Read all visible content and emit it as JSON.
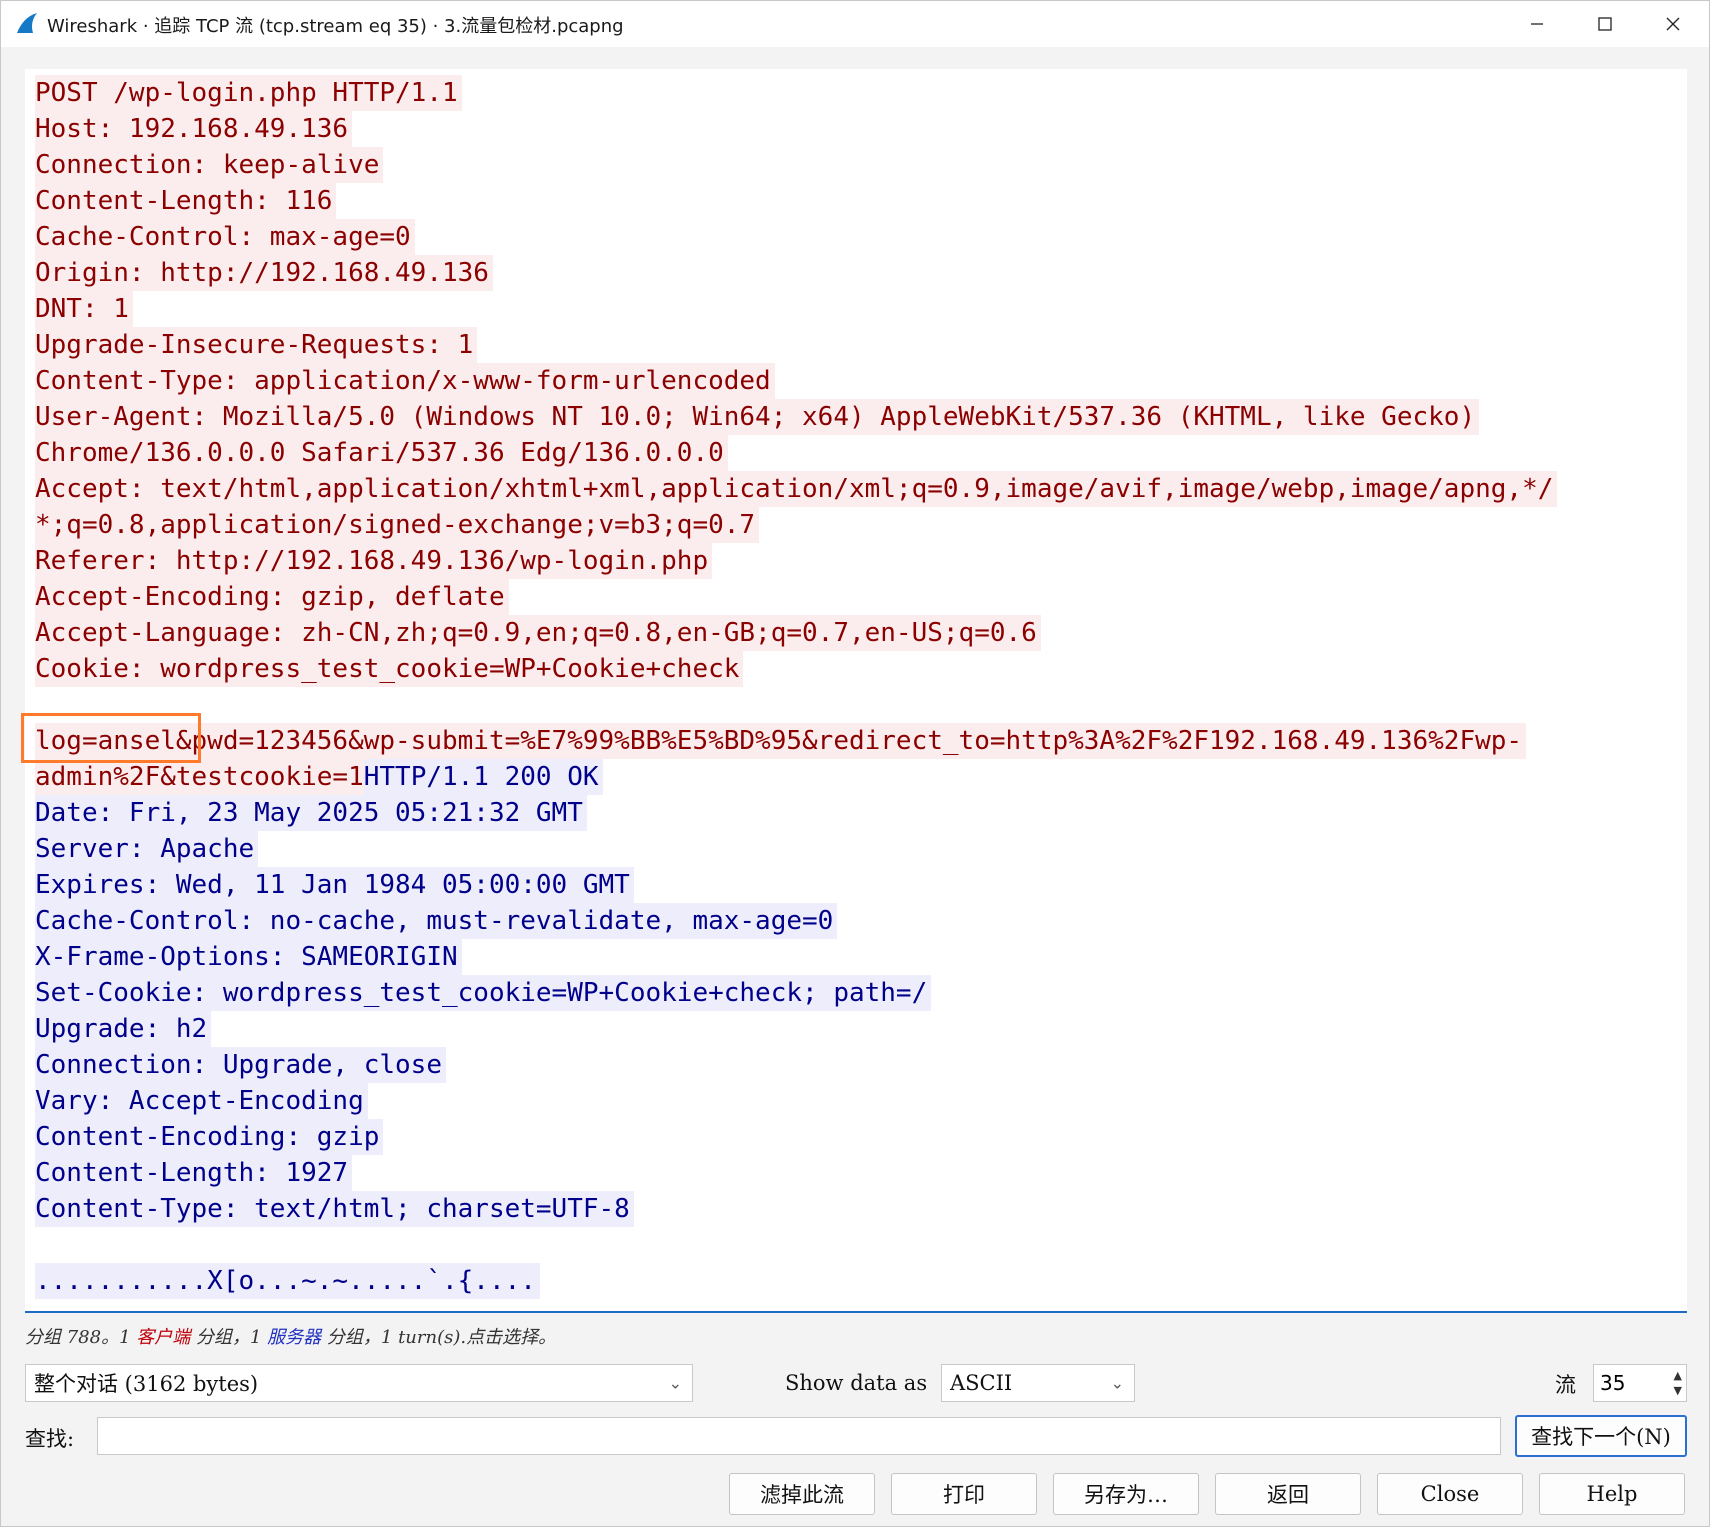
{
  "window": {
    "title": "Wireshark · 追踪 TCP 流 (tcp.stream eq 35) · 3.流量包检材.pcapng",
    "minimize_icon": "minimize-icon",
    "maximize_icon": "maximize-icon",
    "close_icon": "close-icon"
  },
  "colors": {
    "client_fg": "#8b0000",
    "client_bg": "#fbeded",
    "server_fg": "#00008b",
    "server_bg": "#ededfb",
    "highlight_box": "#ff7a2a",
    "accent": "#1a6dc2"
  },
  "stream": {
    "client_lines": [
      "POST /wp-login.php HTTP/1.1",
      "Host: 192.168.49.136",
      "Connection: keep-alive",
      "Content-Length: 116",
      "Cache-Control: max-age=0",
      "Origin: http://192.168.49.136",
      "DNT: 1",
      "Upgrade-Insecure-Requests: 1",
      "Content-Type: application/x-www-form-urlencoded",
      "User-Agent: Mozilla/5.0 (Windows NT 10.0; Win64; x64) AppleWebKit/537.36 (KHTML, like Gecko)",
      "Chrome/136.0.0.0 Safari/537.36 Edg/136.0.0.0",
      "Accept: text/html,application/xhtml+xml,application/xml;q=0.9,image/avif,image/webp,image/apng,*/",
      "*;q=0.8,application/signed-exchange;v=b3;q=0.7",
      "Referer: http://192.168.49.136/wp-login.php",
      "Accept-Encoding: gzip, deflate",
      "Accept-Language: zh-CN,zh;q=0.9,en;q=0.8,en-GB;q=0.7,en-US;q=0.6",
      "Cookie: wordpress_test_cookie=WP+Cookie+check"
    ],
    "body_line_1": "log=ansel&pwd=123456&wp-submit=%E7%99%BB%E5%BD%95&redirect_to=http%3A%2F%2F192.168.49.136%2Fwp-",
    "body_line_2_client": "admin%2F&testcookie=1",
    "body_line_2_server": "HTTP/1.1 200 OK",
    "server_lines": [
      "Date: Fri, 23 May 2025 05:21:32 GMT",
      "Server: Apache",
      "Expires: Wed, 11 Jan 1984 05:00:00 GMT",
      "Cache-Control: no-cache, must-revalidate, max-age=0",
      "X-Frame-Options: SAMEORIGIN",
      "Set-Cookie: wordpress_test_cookie=WP+Cookie+check; path=/",
      "Upgrade: h2",
      "Connection: Upgrade, close",
      "Vary: Accept-Encoding",
      "Content-Encoding: gzip",
      "Content-Length: 1927",
      "Content-Type: text/html; charset=UTF-8"
    ],
    "binary_line": "...........X[o...~.~.....`.{...."
  },
  "status": {
    "prefix": "分组 788。1 ",
    "client_word": "客户端",
    "mid": " 分组，1 ",
    "server_word": "服务器",
    "suffix": " 分组，1 turn(s).点击选择。"
  },
  "controls": {
    "conversation_select": "整个对话 (3162 bytes)",
    "show_data_as_label": "Show data as",
    "show_data_as_value": "ASCII",
    "stream_label": "流",
    "stream_number": "35",
    "find_label": "查找:",
    "find_value": "",
    "find_next_button": "查找下一个(N)"
  },
  "buttons": {
    "filter_out": "滤掉此流",
    "print": "打印",
    "save_as": "另存为…",
    "back": "返回",
    "close": "Close",
    "help": "Help"
  }
}
